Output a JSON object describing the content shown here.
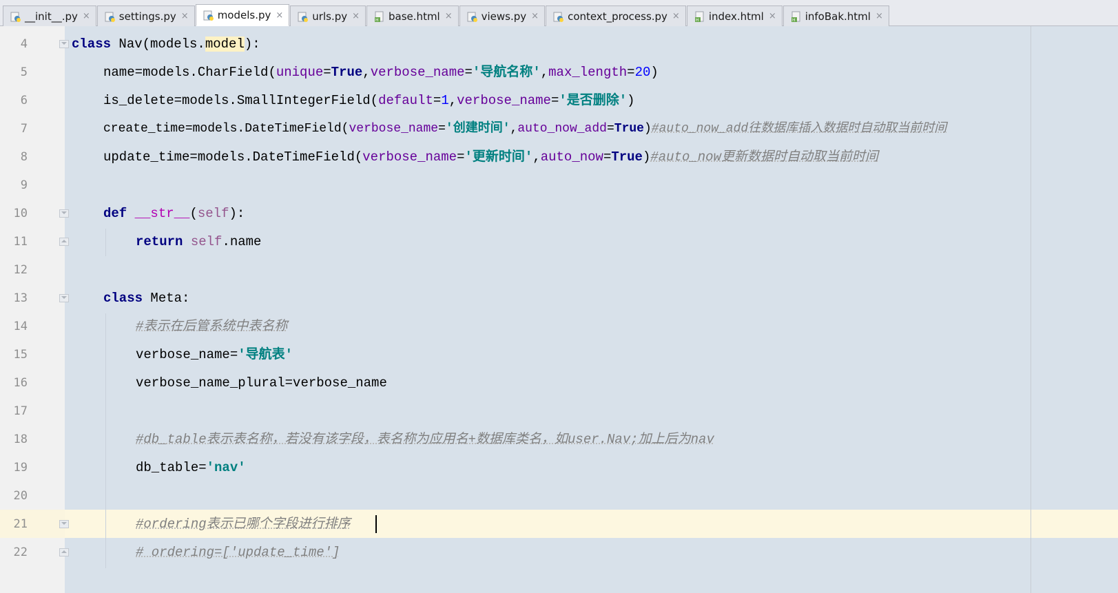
{
  "tabs": [
    {
      "label": "__init__.py",
      "icon": "python-file-icon",
      "active": false
    },
    {
      "label": "settings.py",
      "icon": "python-file-icon",
      "active": false
    },
    {
      "label": "models.py",
      "icon": "python-file-icon",
      "active": true
    },
    {
      "label": "urls.py",
      "icon": "python-file-icon",
      "active": false
    },
    {
      "label": "base.html",
      "icon": "html-file-icon",
      "active": false
    },
    {
      "label": "views.py",
      "icon": "python-file-icon",
      "active": false
    },
    {
      "label": "context_process.py",
      "icon": "python-file-icon",
      "active": false
    },
    {
      "label": "index.html",
      "icon": "html-file-icon",
      "active": false
    },
    {
      "label": "infoBak.html",
      "icon": "html-file-icon",
      "active": false
    }
  ],
  "close_glyph": "×",
  "line_numbers": [
    "4",
    "5",
    "6",
    "7",
    "8",
    "9",
    "10",
    "11",
    "12",
    "13",
    "14",
    "15",
    "16",
    "17",
    "18",
    "19",
    "20",
    "21",
    "22"
  ],
  "code": {
    "l4": {
      "kw": "class",
      "name": " Nav(models.",
      "hl": "model",
      "end": "):"
    },
    "l5": {
      "a": "name=models.CharField(",
      "p1": "unique",
      "eq1": "=",
      "v1": "True",
      "c1": ",",
      "p2": "verbose_name",
      "eq2": "=",
      "s1": "'导航名称'",
      "c2": ",",
      "p3": "max_length",
      "eq3": "=",
      "n1": "20",
      "end": ")"
    },
    "l6": {
      "a": "is_delete=models.SmallIntegerField(",
      "p1": "default",
      "eq1": "=",
      "n1": "1",
      "c1": ",",
      "p2": "verbose_name",
      "eq2": "=",
      "s1": "'是否删除'",
      "end": ")"
    },
    "l7": {
      "a": "create_time=models.DateTimeField(",
      "p1": "verbose_name",
      "eq1": "=",
      "s1": "'创建时间'",
      "c1": ",",
      "p2": "auto_now_add",
      "eq2": "=",
      "v1": "True",
      "end": ")",
      "cm": "#auto_now_add往数据库插入数据时自动取当前时间"
    },
    "l8": {
      "a": "update_time=models.DateTimeField(",
      "p1": "verbose_name",
      "eq1": "=",
      "s1": "'更新时间'",
      "c1": ",",
      "p2": "auto_now",
      "eq2": "=",
      "v1": "True",
      "end": ")",
      "cm": "#auto_now更新数据时自动取当前时间"
    },
    "l10": {
      "kw": "def",
      "sp": " ",
      "fn": "__str__",
      "op": "(",
      "self": "self",
      "end": "):"
    },
    "l11": {
      "kw": "return",
      "sp": " ",
      "self": "self",
      "rest": ".name"
    },
    "l13": {
      "kw": "class",
      "rest": " Meta:"
    },
    "l14": {
      "cm": "#表示在后管系统中表名称"
    },
    "l15": {
      "a": "verbose_name=",
      "s1": "'导航表'"
    },
    "l16": {
      "a": "verbose_name_plural=verbose_name"
    },
    "l18": {
      "cm": "#db_table表示表名称，若没有该字段，表名称为应用名+数据库类名，如user.Nav;加上后为nav"
    },
    "l19": {
      "a": "db_table=",
      "s1": "'nav'"
    },
    "l21": {
      "cm": "#ordering表示已哪个字段进行排序"
    },
    "l22": {
      "cm": "# ordering=['update_time']"
    }
  }
}
